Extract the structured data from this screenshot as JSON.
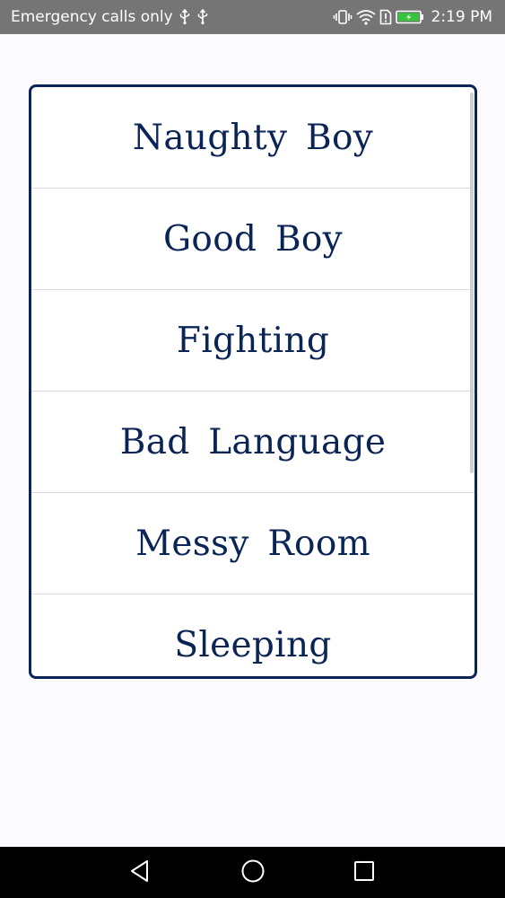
{
  "status_bar": {
    "carrier_text": "Emergency calls only",
    "time": "2:19 PM",
    "icons": [
      "usb-icon",
      "usb-icon",
      "vibrate-icon",
      "wifi-icon",
      "sim-alert-icon",
      "battery-charging-icon"
    ]
  },
  "list": {
    "items": [
      {
        "label": "Naughty Boy"
      },
      {
        "label": "Good Boy"
      },
      {
        "label": "Fighting"
      },
      {
        "label": "Bad Language"
      },
      {
        "label": "Messy Room"
      },
      {
        "label": "Sleeping"
      }
    ]
  },
  "nav_bar": {
    "buttons": [
      "back-icon",
      "home-icon",
      "recents-icon"
    ]
  },
  "colors": {
    "accent": "#0b2456",
    "status_bar_bg": "#757575",
    "battery_green": "#35c43a",
    "nav_bar_bg": "#000000",
    "page_bg": "#fbfafc"
  }
}
